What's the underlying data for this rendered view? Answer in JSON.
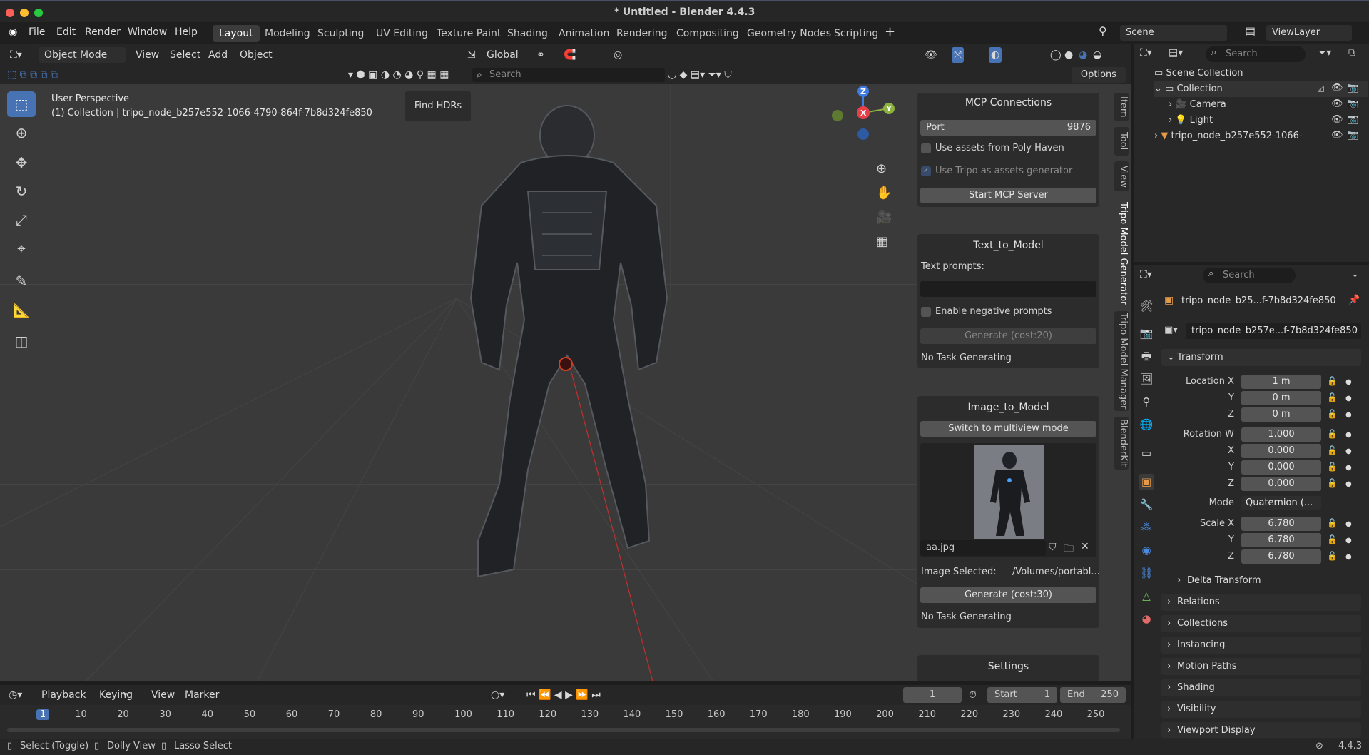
{
  "window": {
    "title": "* Untitled - Blender 4.4.3"
  },
  "menu": {
    "logo": "blender-logo",
    "items": [
      "File",
      "Edit",
      "Render",
      "Window",
      "Help"
    ]
  },
  "workspaces": [
    "Layout",
    "Modeling",
    "Sculpting",
    "UV Editing",
    "Texture Paint",
    "Shading",
    "Animation",
    "Rendering",
    "Compositing",
    "Geometry Nodes",
    "Scripting"
  ],
  "active_workspace": "Layout",
  "scene": {
    "name": "Scene",
    "viewlayer": "ViewLayer"
  },
  "viewport_header": {
    "mode": "Object Mode",
    "menus": [
      "View",
      "Select",
      "Add",
      "Object"
    ],
    "transform": "Global",
    "search_placeholder": "Search",
    "options": "Options"
  },
  "viewport": {
    "perspective": "User Perspective",
    "collection_line": "(1) Collection | tripo_node_b257e552-1066-4790-864f-7b8d324fe850",
    "find_hdrs": "Find HDRs",
    "gizmo": {
      "x": "X",
      "y": "Y",
      "z": "Z"
    }
  },
  "mcp": {
    "title": "MCP Connections",
    "port_label": "Port",
    "port_value": "9876",
    "poly_haven": "Use assets from Poly Haven",
    "tripo_assets": "Use Tripo as assets generator",
    "start": "Start MCP Server"
  },
  "text_to_model": {
    "title": "Text_to_Model",
    "prompts_label": "Text prompts:",
    "prompt_value": "",
    "negative": "Enable negative prompts",
    "generate": "Generate (cost:20)",
    "status": "No Task Generating"
  },
  "image_to_model": {
    "title": "Image_to_Model",
    "multiview": "Switch to multiview mode",
    "filename": "aa.jpg",
    "selected_label": "Image Selected:",
    "selected_path": "/Volumes/portabl...",
    "generate": "Generate (cost:30)",
    "status": "No Task Generating"
  },
  "settings": {
    "title": "Settings"
  },
  "side_tabs": [
    "Item",
    "Tool",
    "View",
    "Tripo Model Generator",
    "Tripo Model Manager",
    "BlenderKit"
  ],
  "outliner": {
    "search_placeholder": "Search",
    "scene_collection": "Scene Collection",
    "collection": "Collection",
    "camera": "Camera",
    "light": "Light",
    "node": "tripo_node_b257e552-1066-"
  },
  "properties": {
    "search_placeholder": "Search",
    "object_name": "tripo_node_b25...f-7b8d324fe850",
    "data_name": "tripo_node_b257e...f-7b8d324fe850",
    "transform": "Transform",
    "location_label": "Location X",
    "location": [
      "1 m",
      "0 m",
      "0 m"
    ],
    "rotation_label": "Rotation W",
    "rotation": [
      "1.000",
      "0.000",
      "0.000",
      "0.000"
    ],
    "mode_label": "Mode",
    "mode_value": "Quaternion (...",
    "scale_label": "Scale X",
    "scale": [
      "6.780",
      "6.780",
      "6.780"
    ],
    "axis_y": "Y",
    "axis_z": "Z",
    "axis_x": "X",
    "delta": "Delta Transform",
    "sections": [
      "Relations",
      "Collections",
      "Instancing",
      "Motion Paths",
      "Shading",
      "Visibility",
      "Viewport Display"
    ]
  },
  "timeline": {
    "menus": [
      "Playback",
      "Keying",
      "View",
      "Marker"
    ],
    "current": "1",
    "start_label": "Start",
    "start": "1",
    "end_label": "End",
    "end": "250",
    "ticks": [
      "1",
      "10",
      "20",
      "30",
      "40",
      "50",
      "60",
      "70",
      "80",
      "90",
      "100",
      "110",
      "120",
      "130",
      "140",
      "150",
      "160",
      "170",
      "180",
      "190",
      "200",
      "210",
      "220",
      "230",
      "240",
      "250"
    ]
  },
  "status": {
    "select": "Select (Toggle)",
    "dolly": "Dolly View",
    "lasso": "Lasso Select",
    "version": "4.4.3"
  },
  "colors": {
    "accent": "#4772b3",
    "x_axis": "#e8404a",
    "y_axis": "#8cb33f",
    "z_axis": "#3f7be0"
  }
}
